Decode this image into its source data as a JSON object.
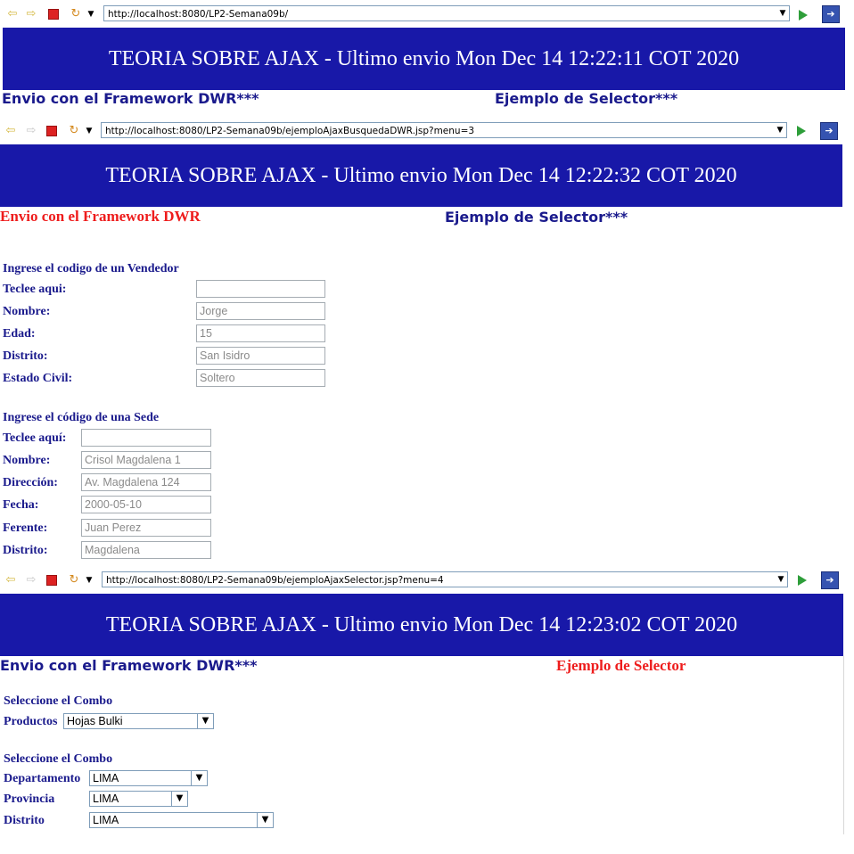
{
  "window1": {
    "url": "http://localhost:8080/LP2-Semana09b/",
    "banner": "TEORIA SOBRE AJAX - Ultimo envio Mon Dec 14 12:22:11 COT 2020",
    "nav": {
      "dwr": "Envio con el Framework DWR***",
      "selector": "Ejemplo de Selector***"
    }
  },
  "window2": {
    "url": "http://localhost:8080/LP2-Semana09b/ejemploAjaxBusquedaDWR.jsp?menu=3",
    "banner": "TEORIA SOBRE AJAX - Ultimo envio Mon Dec 14 12:22:32 COT 2020",
    "nav": {
      "dwr": "Envio con el Framework DWR",
      "selector": "Ejemplo de Selector***"
    },
    "vendedor": {
      "heading": "Ingrese el codigo de un Vendedor",
      "fields": [
        {
          "label": "Teclee aqui:",
          "value": ""
        },
        {
          "label": "Nombre:",
          "value": "Jorge"
        },
        {
          "label": "Edad:",
          "value": "15"
        },
        {
          "label": "Distrito:",
          "value": "San Isidro"
        },
        {
          "label": "Estado Civil:",
          "value": "Soltero"
        }
      ]
    },
    "sede": {
      "heading": "Ingrese el código de una Sede",
      "fields": [
        {
          "label": "Teclee aquí:",
          "value": ""
        },
        {
          "label": "Nombre:",
          "value": "Crisol Magdalena 1"
        },
        {
          "label": "Dirección:",
          "value": "Av. Magdalena 124"
        },
        {
          "label": "Fecha:",
          "value": "2000-05-10"
        },
        {
          "label": "Ferente:",
          "value": "Juan Perez"
        },
        {
          "label": "Distrito:",
          "value": "Magdalena"
        }
      ]
    }
  },
  "window3": {
    "url": "http://localhost:8080/LP2-Semana09b/ejemploAjaxSelector.jsp?menu=4",
    "banner": "TEORIA SOBRE AJAX - Ultimo envio Mon Dec 14 12:23:02 COT 2020",
    "nav": {
      "dwr": "Envio con el Framework DWR***",
      "selector": "Ejemplo de Selector"
    },
    "combo1": {
      "heading": "Seleccione el Combo",
      "label": "Productos",
      "value": "Hojas Bulki"
    },
    "combo2": {
      "heading": "Seleccione el Combo",
      "rows": [
        {
          "label": "Departamento",
          "value": "LIMA"
        },
        {
          "label": "Provincia",
          "value": "LIMA"
        },
        {
          "label": "Distrito",
          "value": "LIMA"
        }
      ]
    }
  },
  "icons": [
    "back-arrow-icon",
    "forward-arrow-icon",
    "stop-icon",
    "refresh-icon",
    "dropdown-icon",
    "go-icon",
    "browser-extension-icon"
  ],
  "colors": {
    "banner_bg": "#1818a8",
    "nav_text": "#1a1a8c",
    "active_nav": "#ee1c1c",
    "go_green": "#2e9e3a"
  }
}
